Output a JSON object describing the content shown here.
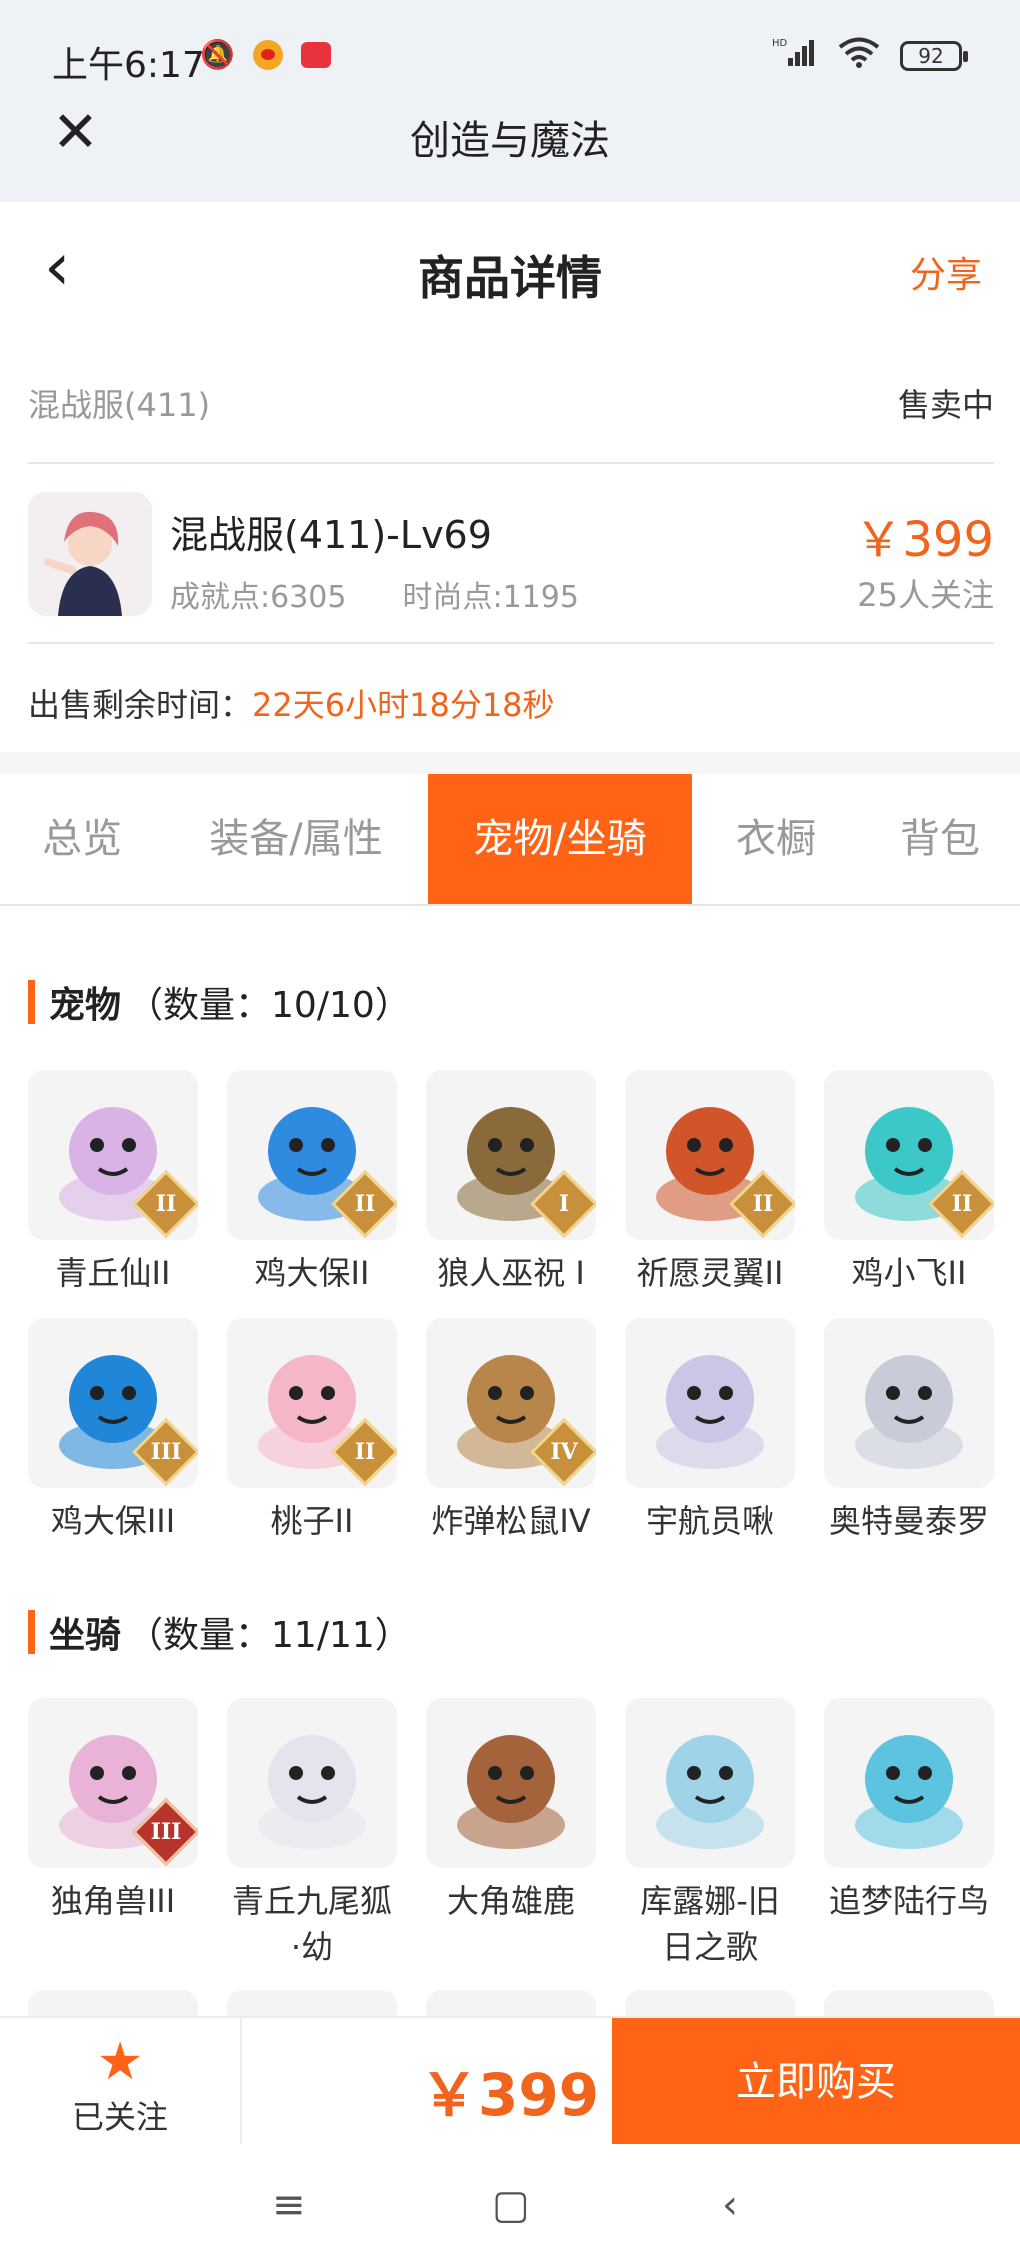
{
  "status": {
    "time": "上午6:17",
    "battery": "92",
    "icons": [
      "mute-icon",
      "weibo-icon",
      "app-notification-icon",
      "hd-signal-icon",
      "wifi-icon",
      "battery-icon"
    ]
  },
  "app_bar": {
    "title": "创造与魔法",
    "close_icon": "close-icon"
  },
  "header": {
    "title": "商品详情",
    "share": "分享",
    "back_icon": "chevron-left-icon"
  },
  "server": {
    "name": "混战服(411)",
    "status": "售卖中"
  },
  "product": {
    "title": "混战服(411)-Lv69",
    "achievement": "成就点:6305",
    "fashion": "时尚点:1195",
    "price": "￥399",
    "followers": "25人关注"
  },
  "remaining": {
    "label": "出售剩余时间：",
    "value": "22天6小时18分18秒"
  },
  "tabs": [
    "总览",
    "装备/属性",
    "宠物/坐骑",
    "衣橱",
    "背包"
  ],
  "active_tab": "宠物/坐骑",
  "pets": {
    "title": "宠物",
    "count": "（数量：10/10）",
    "items": [
      {
        "name": "青丘仙II",
        "badge": "II",
        "color": "#d9b3e6"
      },
      {
        "name": "鸡大保II",
        "badge": "II",
        "color": "#2f8be0"
      },
      {
        "name": "狼人巫祝 I",
        "badge": "I",
        "color": "#8a6a3a"
      },
      {
        "name": "祈愿灵翼II",
        "badge": "II",
        "color": "#d0562a"
      },
      {
        "name": "鸡小飞II",
        "badge": "II",
        "color": "#3cc7c9"
      },
      {
        "name": "鸡大保III",
        "badge": "III",
        "color": "#1f86d8"
      },
      {
        "name": "桃子II",
        "badge": "II",
        "color": "#f5b7c8"
      },
      {
        "name": "炸弹松鼠IV",
        "badge": "IV",
        "color": "#b8864a"
      },
      {
        "name": "宇航员啾",
        "badge": "",
        "color": "#c9c6e6"
      },
      {
        "name": "奥特曼泰罗",
        "badge": "",
        "color": "#c8ccd8"
      }
    ]
  },
  "mounts": {
    "title": "坐骑",
    "count": "（数量：11/11）",
    "items": [
      {
        "name": "独角兽III",
        "badge": "III",
        "color": "#e8b3d6"
      },
      {
        "name": "青丘九尾狐·幼",
        "badge": "",
        "color": "#e3e4ee"
      },
      {
        "name": "大角雄鹿",
        "badge": "",
        "color": "#a4633a"
      },
      {
        "name": "库露娜-旧日之歌",
        "badge": "",
        "color": "#9fd3e8"
      },
      {
        "name": "追梦陆行鸟",
        "badge": "",
        "color": "#5cc4e0"
      }
    ]
  },
  "bottom": {
    "follow_label": "已关注",
    "price": "￥399",
    "buy": "立即购买"
  },
  "colors": {
    "accent": "#ff6416",
    "price": "#f0641e",
    "muted": "#999999"
  }
}
